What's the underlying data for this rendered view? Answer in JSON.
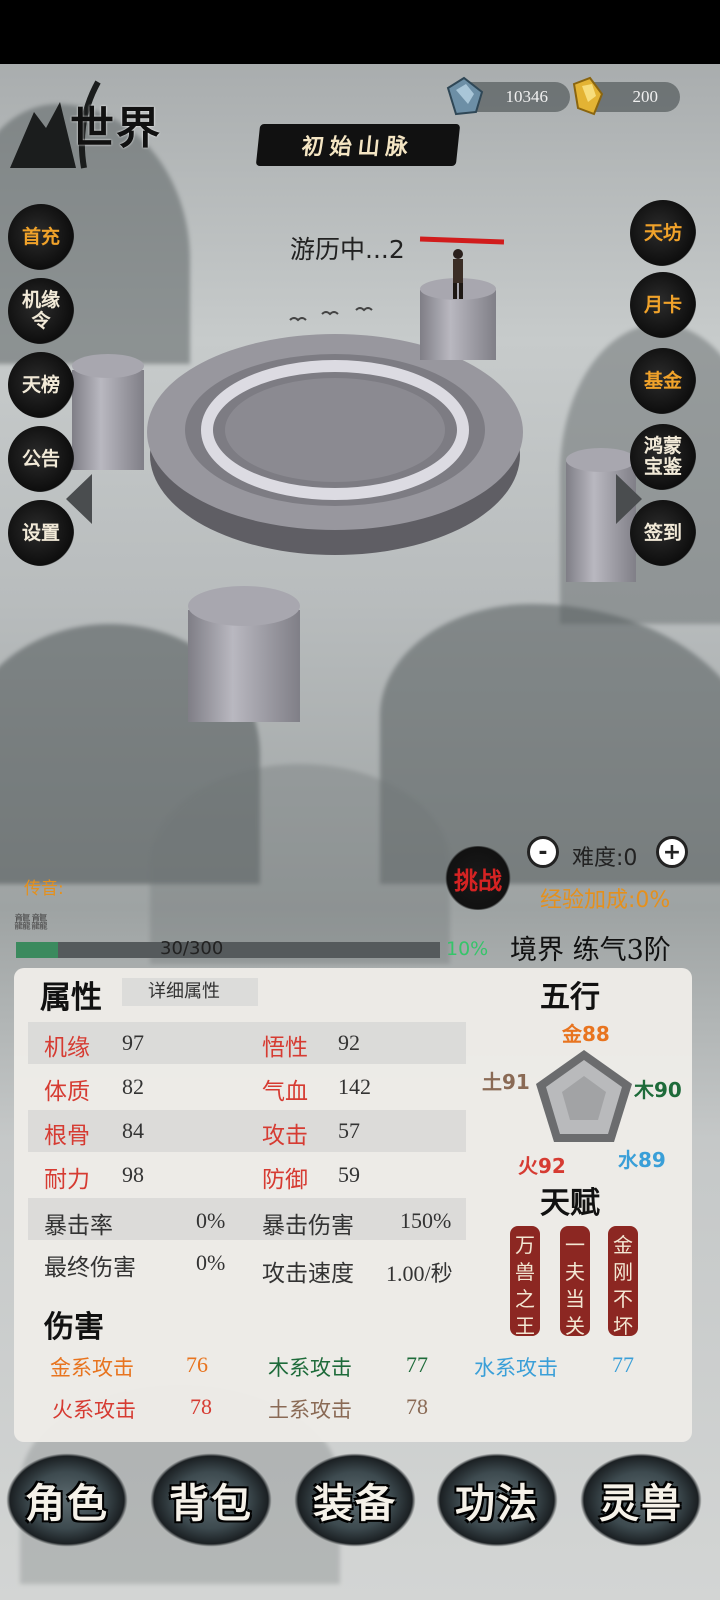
{
  "header": {
    "world_title": "世界",
    "location": "初始山脉",
    "jade_amount": "10346",
    "gold_amount": "200"
  },
  "scene": {
    "status": "游历中...2",
    "challenge_label": "挑战",
    "difficulty_label": "难度:0",
    "minus_label": "-",
    "plus_label": "+",
    "exp_bonus": "经验加成:0%"
  },
  "left_menu": [
    {
      "label": "首充",
      "hot": true
    },
    {
      "label": "机缘令",
      "hot": false
    },
    {
      "label": "天榜",
      "hot": false
    },
    {
      "label": "公告",
      "hot": false
    },
    {
      "label": "设置",
      "hot": false
    }
  ],
  "right_menu": [
    {
      "label": "天坊",
      "hot": true
    },
    {
      "label": "月卡",
      "hot": true
    },
    {
      "label": "基金",
      "hot": true
    },
    {
      "label": "鸿蒙宝鉴",
      "hot": false
    },
    {
      "label": "签到",
      "hot": false
    }
  ],
  "chat": {
    "label": "传音:",
    "text": "龘龘"
  },
  "progress": {
    "text": "30/300",
    "percent_text": "10%",
    "fraction": 0.1
  },
  "realm": {
    "text": "境界 练气3阶"
  },
  "attributes": {
    "title": "属性",
    "detail_tab": "详细属性",
    "jiyuan": {
      "label": "机缘",
      "value": "97"
    },
    "wuxing_stat": {
      "label": "悟性",
      "value": "92"
    },
    "tizhi": {
      "label": "体质",
      "value": "82"
    },
    "qixue": {
      "label": "气血",
      "value": "142"
    },
    "gengu": {
      "label": "根骨",
      "value": "84"
    },
    "gongji": {
      "label": "攻击",
      "value": "57"
    },
    "naili": {
      "label": "耐力",
      "value": "98"
    },
    "fangyu": {
      "label": "防御",
      "value": "59"
    },
    "crit_rate": {
      "label": "暴击率",
      "value": "0%"
    },
    "crit_damage": {
      "label": "暴击伤害",
      "value": "150%"
    },
    "final_damage": {
      "label": "最终伤害",
      "value": "0%"
    },
    "attack_speed": {
      "label": "攻击速度",
      "value": "1.00/秒"
    }
  },
  "damage": {
    "title": "伤害",
    "metal": {
      "label": "金系攻击",
      "value": "76"
    },
    "wood": {
      "label": "木系攻击",
      "value": "77"
    },
    "water": {
      "label": "水系攻击",
      "value": "77"
    },
    "fire": {
      "label": "火系攻击",
      "value": "78"
    },
    "earth": {
      "label": "土系攻击",
      "value": "78"
    }
  },
  "five_elements": {
    "title": "五行",
    "metal": "金88",
    "wood": "木90",
    "water": "水89",
    "fire": "火92",
    "earth": "土91"
  },
  "talents": {
    "title": "天赋",
    "items": [
      "万兽之王",
      "一夫当关",
      "金刚不坏"
    ]
  },
  "bottom_nav": [
    "角色",
    "背包",
    "装备",
    "功法",
    "灵兽"
  ],
  "colors": {
    "hot": "#f0a22a",
    "attr_red": "#d63b32",
    "metal": "#e8741f",
    "wood": "#1e6b3a",
    "water": "#3a9fd8",
    "fire": "#d63b32",
    "earth": "#8a6a55",
    "progress": "#3b8a5e",
    "percent_green": "#36c46a"
  }
}
